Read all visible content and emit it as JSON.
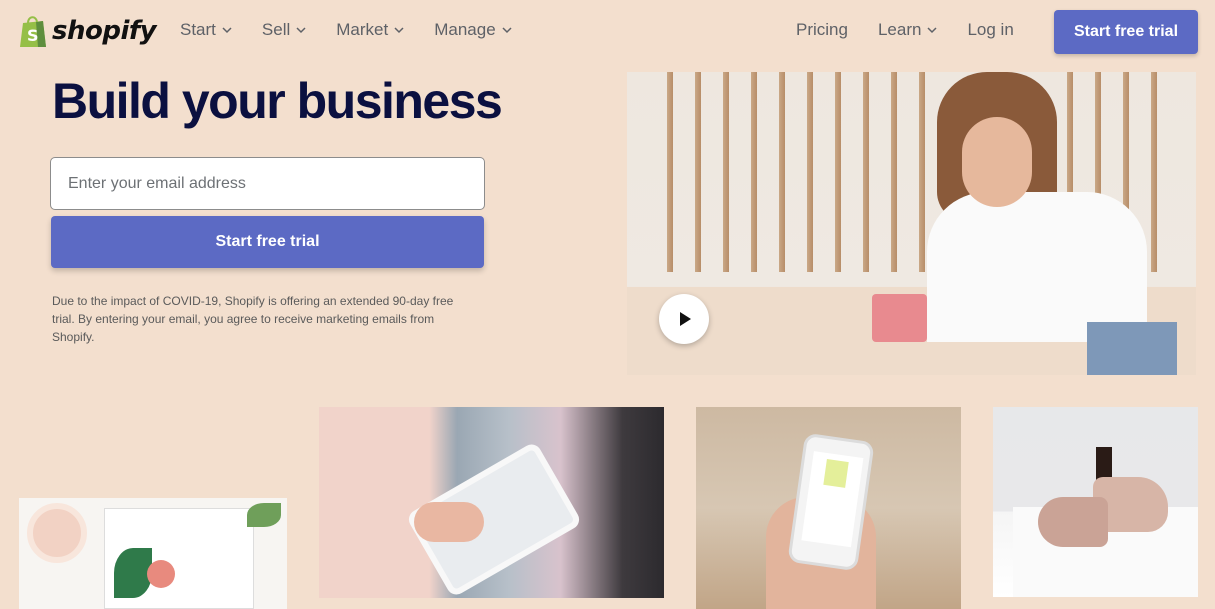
{
  "brand": {
    "name": "shopify",
    "color": "#95bf47"
  },
  "nav": {
    "left_items": [
      {
        "label": "Start",
        "has_dropdown": true
      },
      {
        "label": "Sell",
        "has_dropdown": true
      },
      {
        "label": "Market",
        "has_dropdown": true
      },
      {
        "label": "Manage",
        "has_dropdown": true
      }
    ],
    "right_items": [
      {
        "label": "Pricing",
        "has_dropdown": false
      },
      {
        "label": "Learn",
        "has_dropdown": true
      },
      {
        "label": "Log in",
        "has_dropdown": false
      }
    ],
    "cta_label": "Start free trial"
  },
  "hero": {
    "title": "Build your business",
    "email_placeholder": "Enter your email address",
    "cta_label": "Start free trial",
    "disclaimer": "Due to the impact of COVID-19, Shopify is offering an extended 90-day free trial. By entering your email, you agree to receive marketing emails from Shopify."
  },
  "colors": {
    "accent": "#5c6ac4",
    "background": "#f3dfce",
    "title": "#0b1040"
  },
  "icons": [
    "shopify-bag-icon",
    "chevron-down-icon",
    "play-icon"
  ]
}
